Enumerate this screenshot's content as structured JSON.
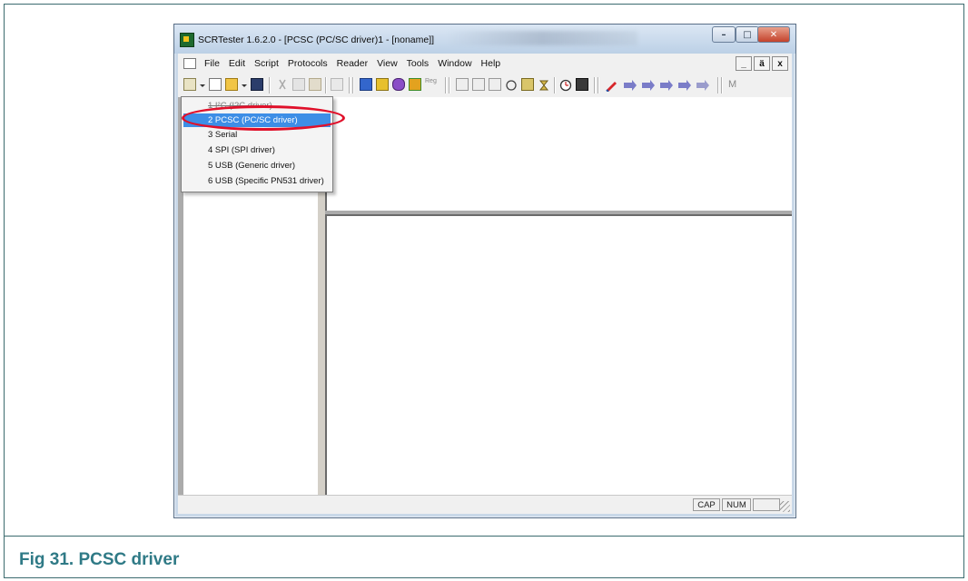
{
  "caption": "Fig 31.   PCSC driver",
  "window": {
    "title": "SCRTester 1.6.2.0 - [PCSC (PC/SC driver)1 - [noname]]",
    "controls": {
      "minimize": "–",
      "maximize": "□",
      "close": "✕"
    }
  },
  "menu": {
    "items": [
      "File",
      "Edit",
      "Script",
      "Protocols",
      "Reader",
      "View",
      "Tools",
      "Window",
      "Help"
    ],
    "mdi": {
      "minimize": "_",
      "restore": "ä",
      "close": "x"
    }
  },
  "toolbar": {
    "icons": [
      "connect-icon",
      "new-icon",
      "open-icon",
      "save-icon",
      "cut-icon",
      "copy-icon",
      "paste-icon",
      "print-icon",
      "apdu-icon",
      "send-icon",
      "erase-icon",
      "grid-icon",
      "reg-icon",
      "step-icon",
      "run-icon",
      "stop-icon",
      "hand-icon",
      "debug-icon",
      "config-icon",
      "timer-icon",
      "calc-icon",
      "pen-icon",
      "arrow1-icon",
      "arrow2-icon",
      "arrow3-icon",
      "arrow4-icon",
      "arrow5-icon",
      "m-icon"
    ],
    "reg_label": "Reg",
    "m_label": "M"
  },
  "dropdown": {
    "items": [
      {
        "label": "1 I²C (I2C driver)",
        "selected": false,
        "struck": true
      },
      {
        "label": "2 PCSC (PC/SC driver)",
        "selected": true,
        "struck": false
      },
      {
        "label": "3 Serial",
        "selected": false,
        "struck": false
      },
      {
        "label": "4 SPI (SPI driver)",
        "selected": false,
        "struck": false
      },
      {
        "label": "5 USB (Generic driver)",
        "selected": false,
        "struck": false
      },
      {
        "label": "6 USB (Specific PN531 driver)",
        "selected": false,
        "struck": false
      }
    ]
  },
  "status": {
    "cap": "CAP",
    "num": "NUM",
    "empty": ""
  },
  "colors": {
    "caption": "#2f7a86",
    "highlight": "#e0102a",
    "selection": "#3d8ee6"
  }
}
